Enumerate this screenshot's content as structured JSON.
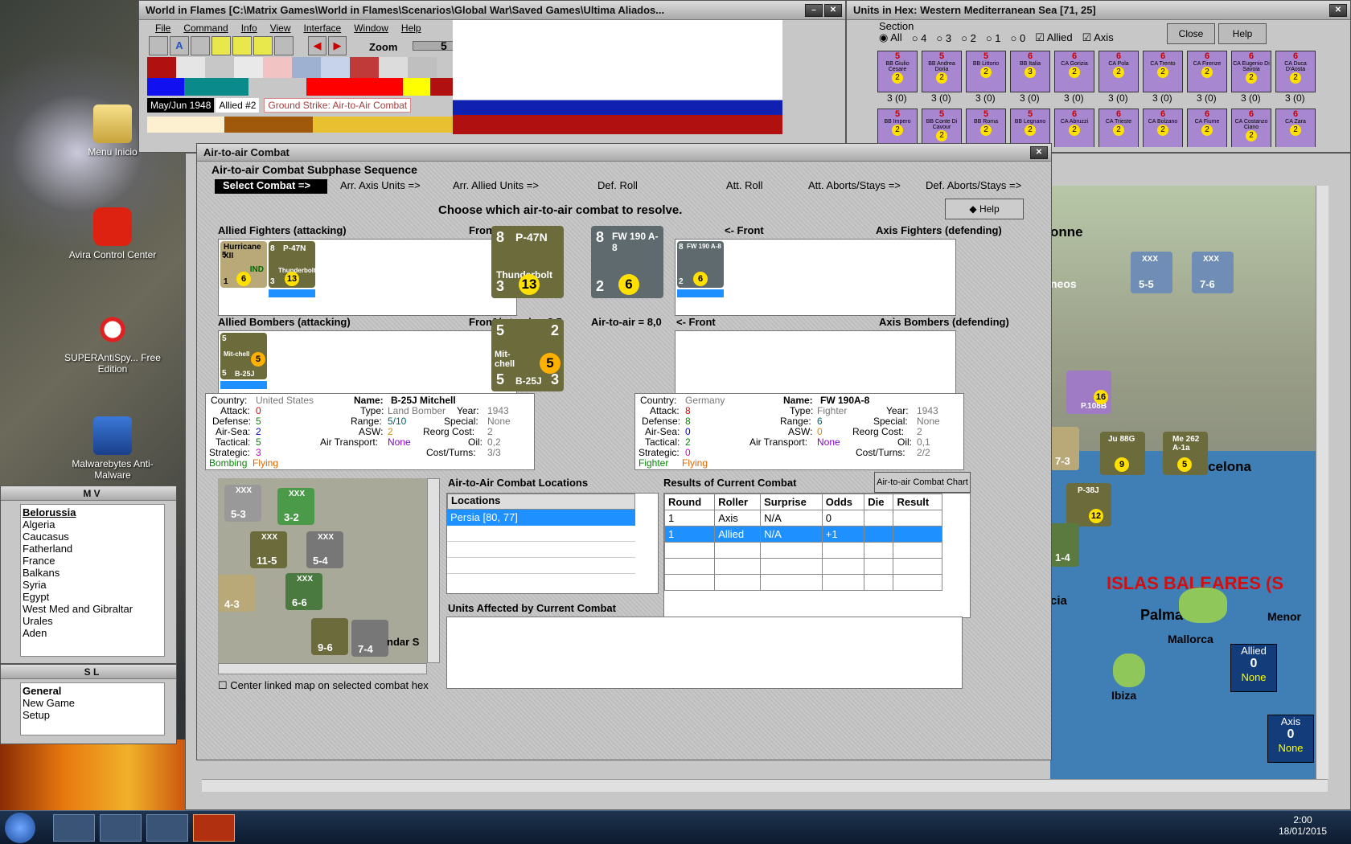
{
  "desktop": {
    "icons": [
      {
        "label": "Menu Inicio",
        "icon": "folder-icon"
      },
      {
        "label": "Avira Control Center",
        "icon": "avira-icon"
      },
      {
        "label": "SUPERAntiSpy... Free Edition",
        "icon": "superantispyware-icon"
      },
      {
        "label": "Malwarebytes Anti-Malware",
        "icon": "malwarebytes-icon"
      }
    ]
  },
  "main_window": {
    "title": "World in Flames [C:\\Matrix Games\\World in Flames\\Scenarios\\Global War\\Saved Games\\Ultima Aliados...",
    "menu": [
      "File",
      "Command",
      "Info",
      "View",
      "Interface",
      "Window",
      "Help"
    ],
    "zoom_label": "Zoom",
    "zoom_value": "5",
    "date": "May/Jun 1948",
    "turn": "Allied #2",
    "phase": "Ground Strike: Air-to-Air Combat"
  },
  "units_window": {
    "title": "Units in Hex: Western Mediterranean Sea [71, 25]",
    "section_label": "Section",
    "section_options": [
      "All",
      "4",
      "3",
      "2",
      "1",
      "0"
    ],
    "allied_label": "Allied",
    "axis_label": "Axis",
    "close_label": "Close",
    "help_label": "Help",
    "ships_row1": [
      {
        "name": "BB Giulio Cesare",
        "top": "5",
        "mid": "2",
        "bot": "3 (0)"
      },
      {
        "name": "BB Andrea Doria",
        "top": "5",
        "mid": "2",
        "bot": "3 (0)"
      },
      {
        "name": "BB Littorio",
        "top": "5",
        "mid": "2",
        "bot": "3 (0)"
      },
      {
        "name": "BB Italia",
        "top": "6",
        "mid": "3",
        "bot": "3 (0)"
      },
      {
        "name": "CA Gorizia",
        "top": "6",
        "mid": "2",
        "bot": "3 (0)"
      },
      {
        "name": "CA Pola",
        "top": "6",
        "mid": "2",
        "bot": "3 (0)"
      },
      {
        "name": "CA Trento",
        "top": "6",
        "mid": "2",
        "bot": "3 (0)"
      },
      {
        "name": "CA Firenze",
        "top": "6",
        "mid": "2",
        "bot": "3 (0)"
      },
      {
        "name": "CA Eugenio Di Savoia",
        "top": "6",
        "mid": "2",
        "bot": "3 (0)"
      },
      {
        "name": "CA Duca D'Aosta",
        "top": "6",
        "mid": "2",
        "bot": "3 (0)"
      }
    ],
    "ships_row2": [
      {
        "name": "BB Impero",
        "top": "5",
        "mid": "2"
      },
      {
        "name": "BB Conte Di Cavour",
        "top": "5",
        "mid": "2"
      },
      {
        "name": "BB Roma",
        "top": "5",
        "mid": "2"
      },
      {
        "name": "BB Legnano",
        "top": "5",
        "mid": "2"
      },
      {
        "name": "CA Abruzzi",
        "top": "6",
        "mid": "2"
      },
      {
        "name": "CA Trieste",
        "top": "6",
        "mid": "2"
      },
      {
        "name": "CA Bolzano",
        "top": "6",
        "mid": "2"
      },
      {
        "name": "CA Fiume",
        "top": "6",
        "mid": "2"
      },
      {
        "name": "CA Costanzo Ciano",
        "top": "6",
        "mid": "2"
      },
      {
        "name": "CA Zara",
        "top": "6",
        "mid": "2"
      }
    ]
  },
  "dialog": {
    "title": "Air-to-air Combat",
    "sequence_title": "Air-to-air Combat Subphase Sequence",
    "steps": [
      "Select Combat =>",
      "Arr. Axis Units =>",
      "Arr. Allied Units =>",
      "Def. Roll",
      "Att. Roll",
      "Att. Aborts/Stays =>",
      "Def. Aborts/Stays =>"
    ],
    "instruction": "Choose which air-to-air combat to resolve.",
    "help_label": "Help",
    "allied_fighters_label": "Allied Fighters (attacking)",
    "front_right": "Front ->",
    "front_left": "<- Front",
    "axis_fighters_label": "Axis Fighters (defending)",
    "allied_bombers_label": "Allied Bombers (attacking)",
    "axis_bombers_label": "Axis Bombers (defending)",
    "allied_a2a": "Air-to-air = 8,5",
    "axis_a2a": "Air-to-air = 8,0",
    "allied_fighters": [
      {
        "name": "Hurricane XII",
        "nation": "IND",
        "att": "5",
        "def": "1",
        "range": "6"
      },
      {
        "name": "P-47N",
        "sub": "Thunderbolt",
        "att": "8",
        "def": "3",
        "range": "13"
      }
    ],
    "front_allied_fighter": {
      "name": "P-47N",
      "sub": "Thunderbolt",
      "att": "8",
      "def": "3",
      "range": "13"
    },
    "front_axis_fighter": {
      "name": "FW 190 A-8",
      "att": "8",
      "def": "2",
      "range": "6"
    },
    "axis_fighters": [
      {
        "name": "FW 190 A-8",
        "att": "8",
        "def": "2",
        "range": "6"
      }
    ],
    "allied_bombers": [
      {
        "name": "Mit-chell",
        "sub": "B-25J",
        "att": "5",
        "def": "5",
        "range": "5"
      }
    ],
    "front_allied_bomber": {
      "name": "Mit-chell",
      "sub": "B-25J",
      "att": "5",
      "def": "5",
      "range": "5",
      "a2a": "2",
      "tac": "3"
    },
    "allied_info": {
      "country_label": "Country:",
      "country": "United States",
      "name_label": "Name:",
      "name": "B-25J Mitchell",
      "attack_label": "Attack:",
      "attack": "0",
      "type_label": "Type:",
      "type": "Land Bomber",
      "year_label": "Year:",
      "year": "1943",
      "defense_label": "Defense:",
      "defense": "5",
      "range_label": "Range:",
      "range": "5/10",
      "special_label": "Special:",
      "special": "None",
      "airsea_label": "Air-Sea:",
      "airsea": "2",
      "asw_label": "ASW:",
      "asw": "2",
      "reorg_label": "Reorg Cost:",
      "reorg": "2",
      "tactical_label": "Tactical:",
      "tactical": "5",
      "transport_label": "Air Transport:",
      "transport": "None",
      "oil_label": "Oil:",
      "oil": "0,2",
      "strategic_label": "Strategic:",
      "strategic": "3",
      "cost_label": "Cost/Turns:",
      "cost": "3/3",
      "flags": "Bombing",
      "flags2": "Flying"
    },
    "axis_info": {
      "country_label": "Country:",
      "country": "Germany",
      "name_label": "Name:",
      "name": "FW 190A-8",
      "attack_label": "Attack:",
      "attack": "8",
      "type_label": "Type:",
      "type": "Fighter",
      "year_label": "Year:",
      "year": "1943",
      "defense_label": "Defense:",
      "defense": "8",
      "range_label": "Range:",
      "range": "6",
      "special_label": "Special:",
      "special": "None",
      "airsea_label": "Air-Sea:",
      "airsea": "0",
      "asw_label": "ASW:",
      "asw": "0",
      "reorg_label": "Reorg Cost:",
      "reorg": "2",
      "tactical_label": "Tactical:",
      "tactical": "2",
      "transport_label": "Air Transport:",
      "transport": "None",
      "oil_label": "Oil:",
      "oil": "0,1",
      "strategic_label": "Strategic:",
      "strategic": "0",
      "cost_label": "Cost/Turns:",
      "cost": "2/2",
      "flags": "Fighter",
      "flags2": "Flying"
    },
    "locations_title": "Air-to-Air Combat Locations",
    "locations_header": "Locations",
    "locations": [
      "Persia [80, 77]"
    ],
    "results_title": "Results of Current Combat",
    "chart_button": "Air-to-air Combat Chart",
    "results_headers": [
      "Round",
      "Roller",
      "Surprise",
      "Odds",
      "Die",
      "Result"
    ],
    "results_rows": [
      [
        "1",
        "Axis",
        "N/A",
        "0",
        "",
        ""
      ],
      [
        "1",
        "Allied",
        "N/A",
        "+1",
        "",
        ""
      ]
    ],
    "units_affected_title": "Units Affected by Current Combat",
    "center_checkbox": "Center linked map on selected combat hex",
    "minimap_units": [
      {
        "top": "XXX",
        "val": "5-3"
      },
      {
        "top": "XXX",
        "val": "3-2"
      },
      {
        "top": "XXX",
        "val": "11-5"
      },
      {
        "top": "XXX",
        "val": "5-4"
      },
      {
        "top": "",
        "val": "4-3"
      },
      {
        "top": "XXX",
        "val": "6-6"
      },
      {
        "top": "",
        "val": "9-6"
      },
      {
        "top": "",
        "val": "7-4"
      }
    ],
    "minimap_text": "ndar S"
  },
  "mv_panel": {
    "title": "M V",
    "items": [
      "Belorussia",
      "Algeria",
      "Caucasus",
      "Fatherland",
      "France",
      "Balkans",
      "Syria",
      "Egypt",
      "West Med and Gibraltar",
      "Urales",
      "Aden"
    ]
  },
  "sl_panel": {
    "title": "S L",
    "items": [
      "General",
      "New Game",
      "Setup"
    ]
  },
  "map": {
    "labels": [
      "onne",
      "neos",
      "arcelona",
      "ISLAS BALEARES (S",
      "Palma",
      "Mallorca",
      "Menor",
      "Ibiza",
      "cia"
    ],
    "units": [
      {
        "top": "XXX",
        "val": "5-5"
      },
      {
        "top": "XXX",
        "val": "7-6"
      },
      {
        "name": "P.108B",
        "val": "16"
      },
      {
        "name": "Ju 88G",
        "val": "9"
      },
      {
        "name": "Me 262 A-1a",
        "val": "5"
      },
      {
        "name": "P-38J",
        "val": "12"
      },
      {
        "val": "7-3"
      },
      {
        "val": "1-4"
      }
    ],
    "allied_box": {
      "label": "Allied",
      "value": "0",
      "status": "None"
    },
    "axis_box": {
      "label": "Axis",
      "value": "0",
      "status": "None"
    }
  },
  "taskbar": {
    "time": "2:00",
    "date": "18/01/2015"
  },
  "colors": {
    "selected": "#1e90ff",
    "counter_allied": "#6b6b3c",
    "sea": "#3f7fb6"
  }
}
